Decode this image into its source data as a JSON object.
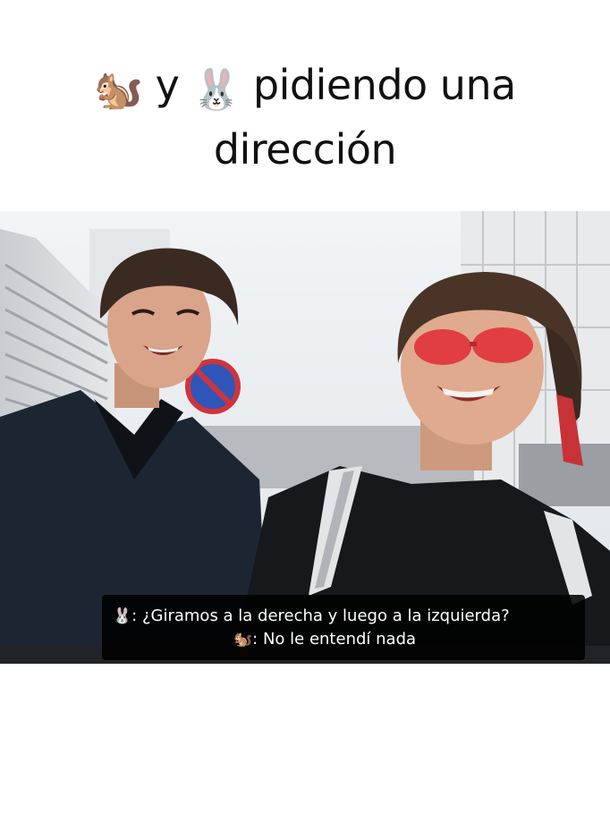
{
  "caption": {
    "emoji_1": "🐿️",
    "word_1": "y",
    "emoji_2": "🐰",
    "text_line_1": "pidiendo una",
    "text_line_2": "dirección"
  },
  "subtitle": {
    "line_1_emoji": "🐰",
    "line_1_text": ": ¿Giramos a la derecha y luego a la izquierda?",
    "line_2_emoji": "🐿️",
    "line_2_text": ": No le entendí nada"
  },
  "colors": {
    "background": "#ffffff",
    "caption_text": "#111111",
    "subtitle_box": "#000000",
    "subtitle_text": "#ffffff",
    "sunglasses": "#e0323a"
  }
}
